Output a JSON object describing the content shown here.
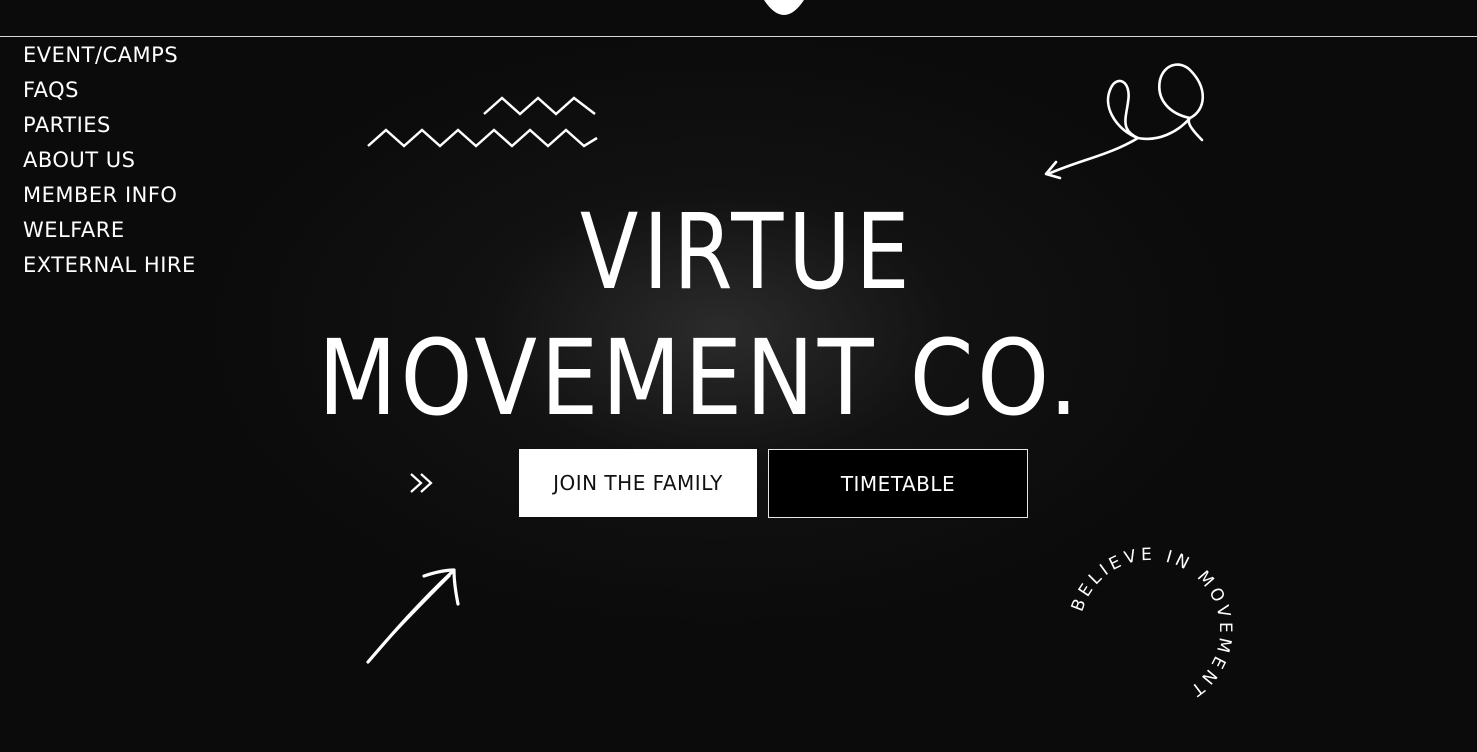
{
  "nav": {
    "items": [
      {
        "label": "EVENT/CAMPS"
      },
      {
        "label": "FAQS"
      },
      {
        "label": "PARTIES"
      },
      {
        "label": "ABOUT US"
      },
      {
        "label": "MEMBER INFO"
      },
      {
        "label": "WELFARE"
      },
      {
        "label": "EXTERNAL HIRE"
      }
    ]
  },
  "hero": {
    "line1": "VIRTUE",
    "line2": "MOVEMENT CO."
  },
  "buttons": {
    "join_label": "JOIN THE FAMILY",
    "timetable_label": "TIMETABLE"
  },
  "badge": {
    "text": "BELIEVE IN MOVEMENT"
  },
  "icons": {
    "logo": "logo-icon",
    "zigzag": "zigzag-doodle-icon",
    "loop_arrow": "loop-arrow-doodle-icon",
    "double_chevron": "double-chevron-icon",
    "up_arrow": "up-right-arrow-doodle-icon"
  },
  "colors": {
    "background": "#0b0b0b",
    "text": "#ffffff",
    "join_button_bg": "#ffffff",
    "timetable_button_bg": "#000000"
  }
}
